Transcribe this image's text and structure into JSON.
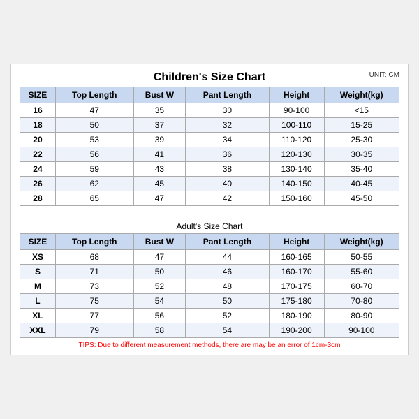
{
  "mainTitle": "Children's Size Chart",
  "unitLabel": "UNIT: CM",
  "children": {
    "headers": [
      "SIZE",
      "Top Length",
      "Bust W",
      "Pant Length",
      "Height",
      "Weight(kg)"
    ],
    "rows": [
      [
        "16",
        "47",
        "35",
        "30",
        "90-100",
        "<15"
      ],
      [
        "18",
        "50",
        "37",
        "32",
        "100-110",
        "15-25"
      ],
      [
        "20",
        "53",
        "39",
        "34",
        "110-120",
        "25-30"
      ],
      [
        "22",
        "56",
        "41",
        "36",
        "120-130",
        "30-35"
      ],
      [
        "24",
        "59",
        "43",
        "38",
        "130-140",
        "35-40"
      ],
      [
        "26",
        "62",
        "45",
        "40",
        "140-150",
        "40-45"
      ],
      [
        "28",
        "65",
        "47",
        "42",
        "150-160",
        "45-50"
      ]
    ]
  },
  "adultsTitle": "Adult's Size Chart",
  "adults": {
    "headers": [
      "SIZE",
      "Top Length",
      "Bust W",
      "Pant Length",
      "Height",
      "Weight(kg)"
    ],
    "rows": [
      [
        "XS",
        "68",
        "47",
        "44",
        "160-165",
        "50-55"
      ],
      [
        "S",
        "71",
        "50",
        "46",
        "160-170",
        "55-60"
      ],
      [
        "M",
        "73",
        "52",
        "48",
        "170-175",
        "60-70"
      ],
      [
        "L",
        "75",
        "54",
        "50",
        "175-180",
        "70-80"
      ],
      [
        "XL",
        "77",
        "56",
        "52",
        "180-190",
        "80-90"
      ],
      [
        "XXL",
        "79",
        "58",
        "54",
        "190-200",
        "90-100"
      ]
    ]
  },
  "tipsText": "TIPS: Due to different measurement methods, there are may be an error of 1cm-3cm"
}
